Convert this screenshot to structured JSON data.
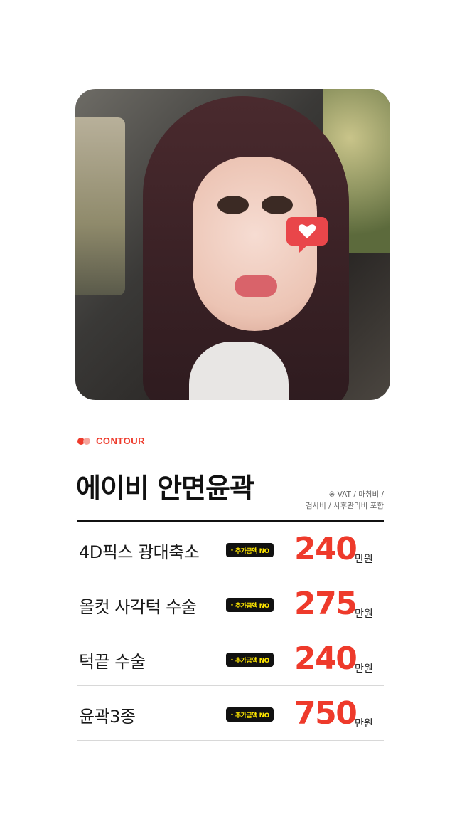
{
  "hero": {
    "icon": "heart-icon",
    "colors": {
      "badge": "#e9464a"
    }
  },
  "category": {
    "label": "CONTOUR",
    "colors": {
      "accent": "#ee3a2b",
      "accent_light": "#f6a49c"
    }
  },
  "title": "에이비 안면윤곽",
  "note": {
    "line1": "※ VAT / 마취비 /",
    "line2": "검사비 / 사후관리비 포함"
  },
  "price_list": {
    "unit": "만원",
    "badge_bullet": "•",
    "items": [
      {
        "name": "4D픽스 광대축소",
        "badge": "추가금액 NO",
        "price": "240",
        "unit": "만원"
      },
      {
        "name": "올컷 사각턱 수술",
        "badge": "추가금액 NO",
        "price": "275",
        "unit": "만원"
      },
      {
        "name": "턱끝 수술",
        "badge": "추가금액 NO",
        "price": "240",
        "unit": "만원"
      },
      {
        "name": "윤곽3종",
        "badge": "추가금액 NO",
        "price": "750",
        "unit": "만원"
      }
    ],
    "colors": {
      "price": "#ee3a2b",
      "badge_bg": "#111111",
      "badge_text": "#ffe600"
    }
  }
}
